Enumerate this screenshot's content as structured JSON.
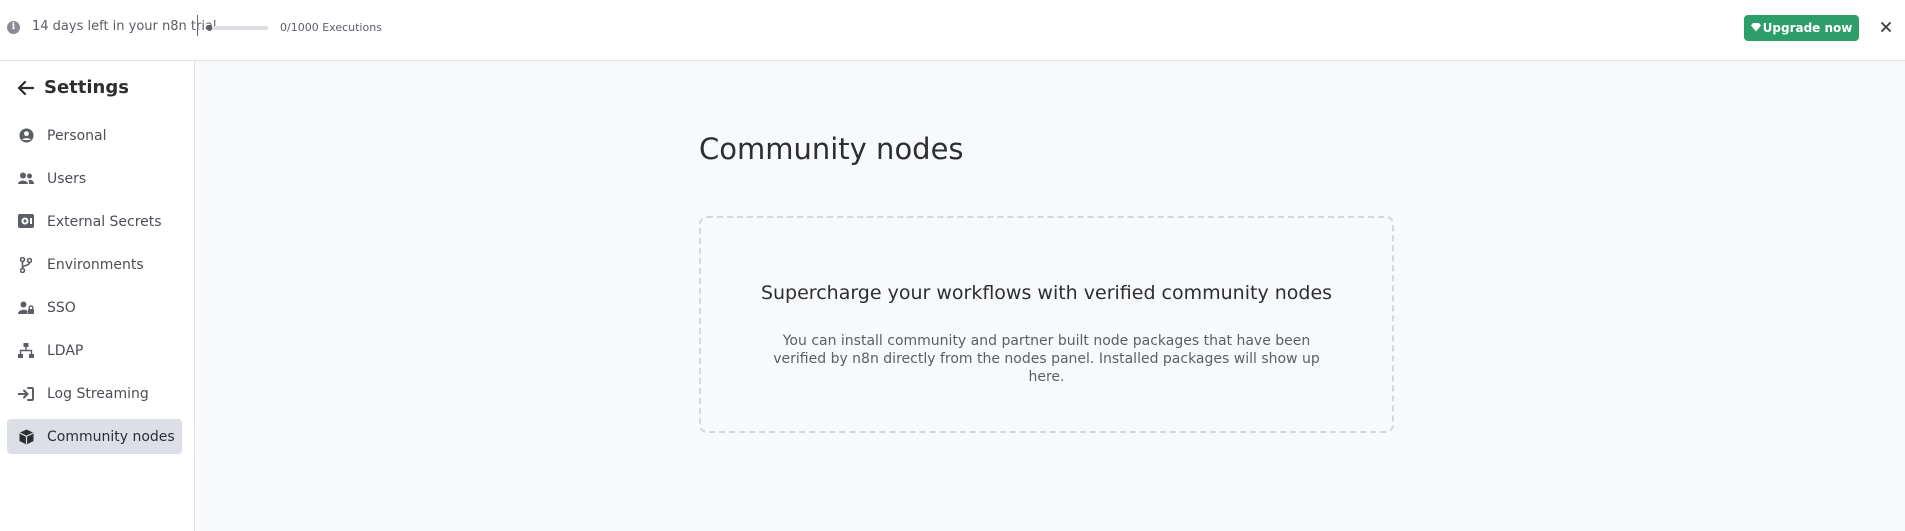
{
  "banner": {
    "trial_text": "14 days left in your n8n trial",
    "executions_text": "0/1000 Executions",
    "executions_progress": 0,
    "upgrade_label": "Upgrade now",
    "close_glyph": "✕",
    "info_icon": "info-icon",
    "upgrade_icon": "gem-icon",
    "accent_color": "#2e9e68"
  },
  "sidebar": {
    "title": "Settings",
    "back_icon": "arrow-left-icon",
    "items": [
      {
        "label": "Personal",
        "icon": "user-circle-icon",
        "active": false
      },
      {
        "label": "Users",
        "icon": "users-icon",
        "active": false
      },
      {
        "label": "External Secrets",
        "icon": "vault-icon",
        "active": false
      },
      {
        "label": "Environments",
        "icon": "branch-icon",
        "active": false
      },
      {
        "label": "SSO",
        "icon": "user-lock-icon",
        "active": false
      },
      {
        "label": "LDAP",
        "icon": "network-icon",
        "active": false
      },
      {
        "label": "Log Streaming",
        "icon": "sign-in-icon",
        "active": false
      },
      {
        "label": "Community nodes",
        "icon": "cube-icon",
        "active": true
      }
    ],
    "active_bg": "#dcdfe6"
  },
  "main": {
    "title": "Community nodes",
    "empty_state": {
      "heading": "Supercharge your workflows with verified community nodes",
      "description": "You can install community and partner built node packages that have been verified by n8n directly from the nodes panel. Installed packages will show up here."
    }
  }
}
